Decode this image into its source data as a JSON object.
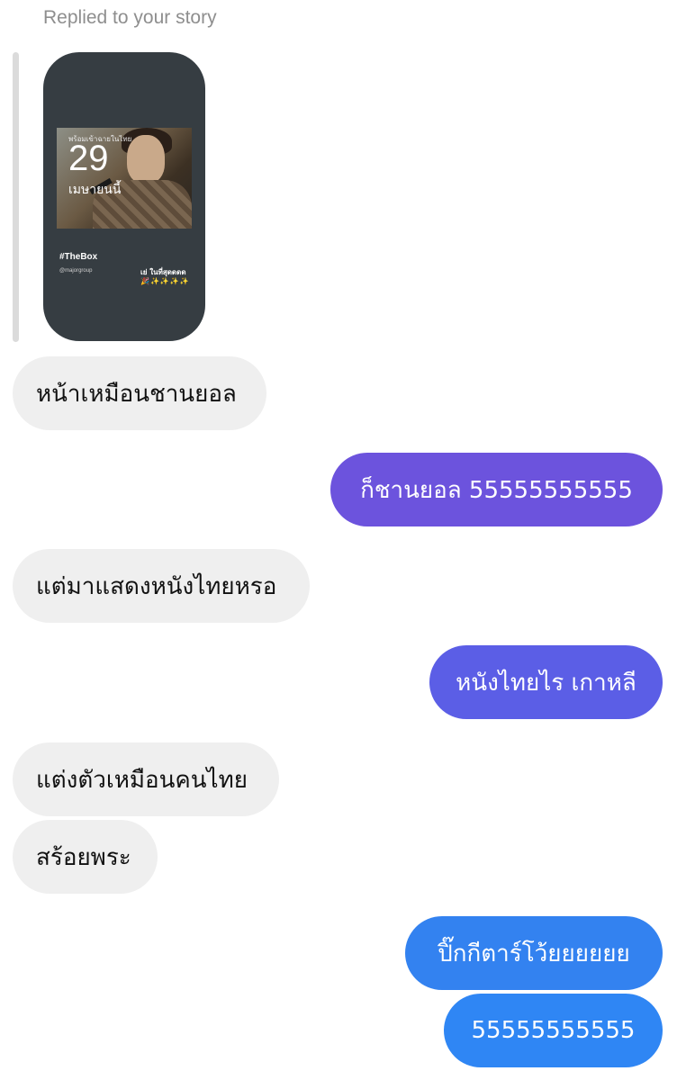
{
  "reply_header": "Replied to your story",
  "story": {
    "small_text": "พร้อมเข้าฉายในไทย",
    "date": "29",
    "month": "เมษายนนี้",
    "hashtag": "#TheBox",
    "handle": "@majorgroup",
    "caption": "เย่  ในที่สุดดดด",
    "emoji": "🎉✨✨✨✨"
  },
  "messages": [
    {
      "direction": "incoming",
      "text": "หน้าเหมือนชานยอล"
    },
    {
      "direction": "outgoing",
      "text": "ก็ชานยอล 55555555555",
      "color": "#6c53dd"
    },
    {
      "direction": "incoming",
      "text": "แต่มาแสดงหนังไทยหรอ"
    },
    {
      "direction": "outgoing",
      "text": "หนังไทยไร เกาหลี",
      "color": "#5b5ee6"
    },
    {
      "direction": "incoming",
      "text": "แต่งตัวเหมือนคนไทย"
    },
    {
      "direction": "incoming",
      "text": "สร้อยพระ"
    },
    {
      "direction": "outgoing",
      "text": "ปิ๊กกีตาร์โว้ยยยยยย",
      "color": "#3382f0"
    },
    {
      "direction": "outgoing",
      "text": "55555555555",
      "color": "#2f86f4"
    }
  ]
}
